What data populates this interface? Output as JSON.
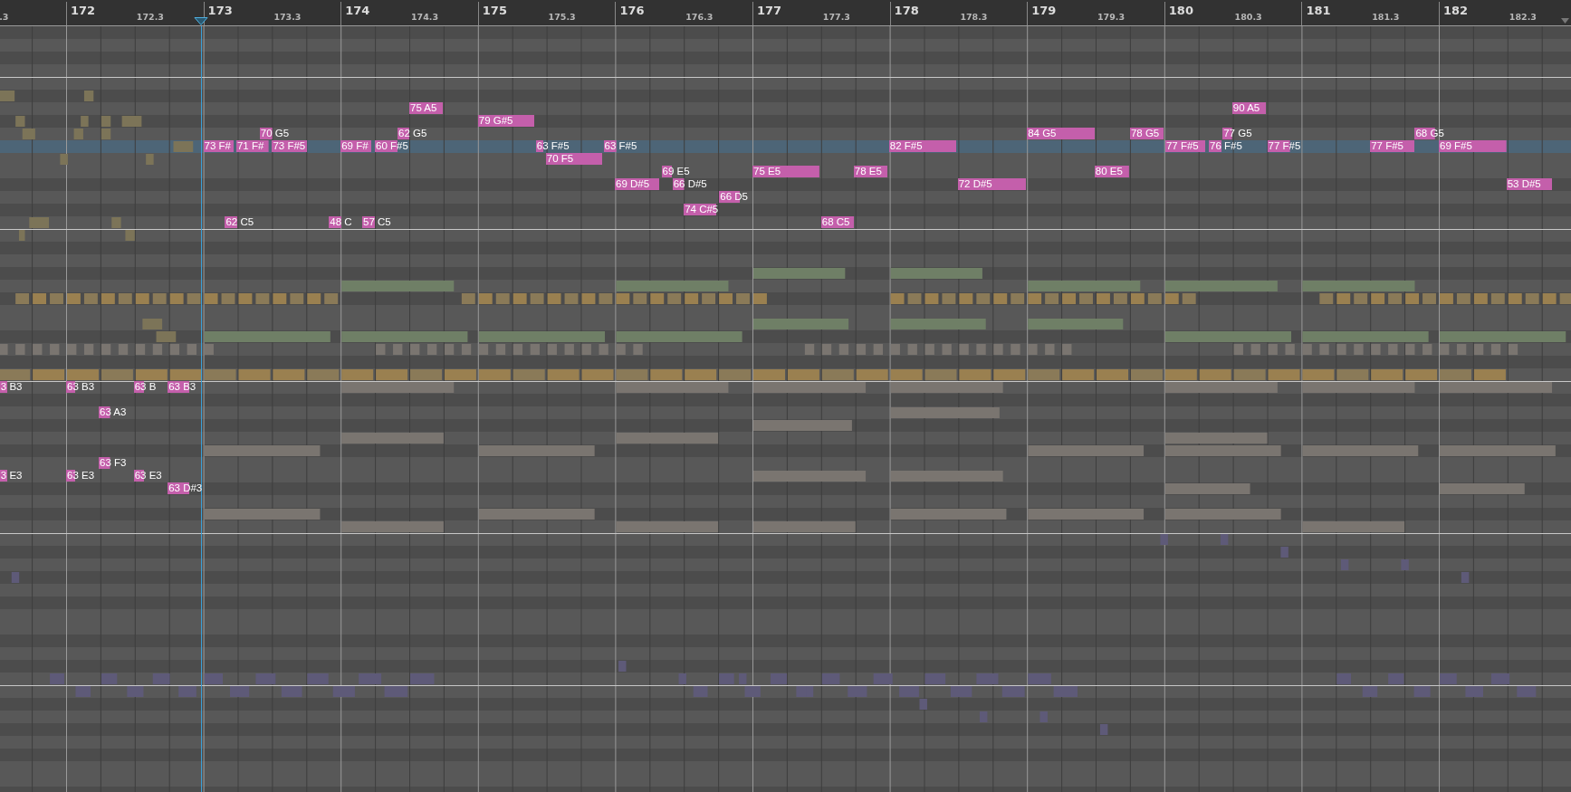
{
  "ruler": {
    "lead_sub": ".3",
    "bars": [
      {
        "number": "172",
        "sub": "172.3"
      },
      {
        "number": "173",
        "sub": "173.3"
      },
      {
        "number": "174",
        "sub": "174.3"
      },
      {
        "number": "175",
        "sub": "175.3"
      },
      {
        "number": "176",
        "sub": "176.3"
      },
      {
        "number": "177",
        "sub": "177.3"
      },
      {
        "number": "178",
        "sub": "178.3"
      },
      {
        "number": "179",
        "sub": "179.3"
      },
      {
        "number": "180",
        "sub": "180.3"
      },
      {
        "number": "181",
        "sub": "181.3"
      },
      {
        "number": "182",
        "sub": "182.3"
      }
    ]
  },
  "notes": [
    {
      "label": "75 A5"
    },
    {
      "label": "79 G#5"
    },
    {
      "label": "70 G5"
    },
    {
      "label": "62 G5"
    },
    {
      "label": "73 F#"
    },
    {
      "label": "71 F#"
    },
    {
      "label": "73 F#5"
    },
    {
      "label": "69 F#"
    },
    {
      "label": "60 F#5"
    },
    {
      "label": "63 F#5"
    },
    {
      "label": "63 F#5"
    },
    {
      "label": "70 F5"
    },
    {
      "label": "69 E5"
    },
    {
      "label": "69 D#5"
    },
    {
      "label": "66 D#5"
    },
    {
      "label": "66 D5"
    },
    {
      "label": "74 C#5"
    },
    {
      "label": "62 C5"
    },
    {
      "label": "48 C"
    },
    {
      "label": "57 C5"
    },
    {
      "label": "75 E5"
    },
    {
      "label": "78 E5"
    },
    {
      "label": "80 E5"
    },
    {
      "label": "68 C5"
    },
    {
      "label": "82 F#5"
    },
    {
      "label": "72 D#5"
    },
    {
      "label": "84 G5"
    },
    {
      "label": "78 G5"
    },
    {
      "label": "90 A5"
    },
    {
      "label": "77 F#5"
    },
    {
      "label": "76 F#5"
    },
    {
      "label": "77 G5"
    },
    {
      "label": "77 F#5"
    },
    {
      "label": "77 F#5"
    },
    {
      "label": "68 G5"
    },
    {
      "label": "69 F#5"
    },
    {
      "label": "53 D#5"
    },
    {
      "label": "3 B3"
    },
    {
      "label": "63 B3"
    },
    {
      "label": "63 B"
    },
    {
      "label": "63 B3"
    },
    {
      "label": "63 A3"
    },
    {
      "label": "63 F3"
    },
    {
      "label": "3 E3"
    },
    {
      "label": "63 E3"
    },
    {
      "label": "63 E3"
    },
    {
      "label": "63 D#3"
    }
  ]
}
